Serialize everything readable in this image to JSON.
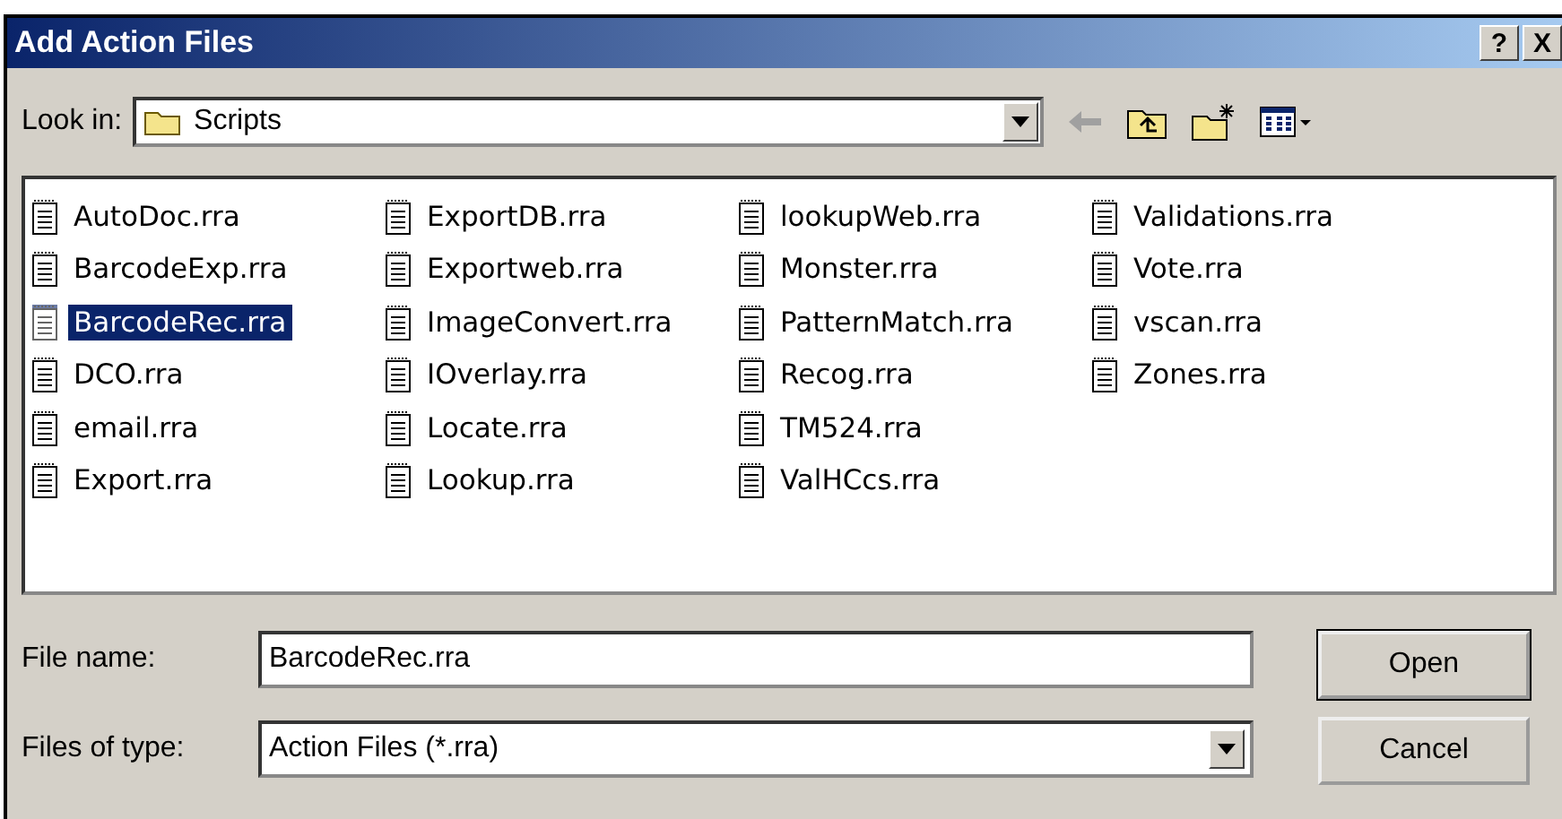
{
  "window": {
    "title": "Add Action Files"
  },
  "title_buttons": [
    "?",
    "X"
  ],
  "look_in": {
    "label": "Look in:",
    "value": "Scripts"
  },
  "files": [
    {
      "name": "AutoDoc.rra",
      "selected": false
    },
    {
      "name": "BarcodeExp.rra",
      "selected": false
    },
    {
      "name": "BarcodeRec.rra",
      "selected": true
    },
    {
      "name": "DCO.rra",
      "selected": false
    },
    {
      "name": "email.rra",
      "selected": false
    },
    {
      "name": "Export.rra",
      "selected": false
    },
    {
      "name": "ExportDB.rra",
      "selected": false
    },
    {
      "name": "Exportweb.rra",
      "selected": false
    },
    {
      "name": "ImageConvert.rra",
      "selected": false
    },
    {
      "name": "IOverlay.rra",
      "selected": false
    },
    {
      "name": "Locate.rra",
      "selected": false
    },
    {
      "name": "Lookup.rra",
      "selected": false
    },
    {
      "name": "lookupWeb.rra",
      "selected": false
    },
    {
      "name": "Monster.rra",
      "selected": false
    },
    {
      "name": "PatternMatch.rra",
      "selected": false
    },
    {
      "name": "Recog.rra",
      "selected": false
    },
    {
      "name": "TM524.rra",
      "selected": false
    },
    {
      "name": "ValHCcs.rra",
      "selected": false
    },
    {
      "name": "Validations.rra",
      "selected": false
    },
    {
      "name": "Vote.rra",
      "selected": false
    },
    {
      "name": "vscan.rra",
      "selected": false
    },
    {
      "name": "Zones.rra",
      "selected": false
    }
  ],
  "file_name": {
    "label": "File name:",
    "value": "BarcodeRec.rra"
  },
  "file_type": {
    "label": "Files of type:",
    "value": "Action Files (*.rra)"
  },
  "buttons": [
    "Open",
    "Cancel"
  ]
}
